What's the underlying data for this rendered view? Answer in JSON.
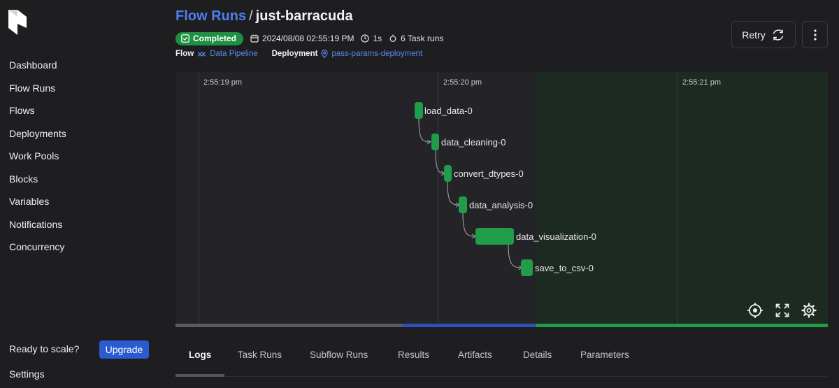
{
  "sidebar": {
    "items": [
      {
        "label": "Dashboard"
      },
      {
        "label": "Flow Runs"
      },
      {
        "label": "Flows"
      },
      {
        "label": "Deployments"
      },
      {
        "label": "Work Pools"
      },
      {
        "label": "Blocks"
      },
      {
        "label": "Variables"
      },
      {
        "label": "Notifications"
      },
      {
        "label": "Concurrency"
      }
    ],
    "ready_text": "Ready to scale?",
    "upgrade_label": "Upgrade",
    "settings_label": "Settings"
  },
  "header": {
    "breadcrumb": "Flow Runs",
    "separator": "/",
    "run_name": "just-barracuda",
    "status": "Completed",
    "start_time": "2024/08/08 02:55:19 PM",
    "duration": "1s",
    "task_runs": "6 Task runs",
    "flow_label": "Flow",
    "flow_name": "Data Pipeline",
    "deployment_label": "Deployment",
    "deployment_name": "pass-params-deployment",
    "retry_label": "Retry"
  },
  "timeline": {
    "ticks": [
      "2:55:19 pm",
      "2:55:20 pm",
      "2:55:21 pm"
    ],
    "tasks": [
      {
        "name": "load_data-0"
      },
      {
        "name": "data_cleaning-0"
      },
      {
        "name": "convert_dtypes-0"
      },
      {
        "name": "data_analysis-0"
      },
      {
        "name": "data_visualization-0"
      },
      {
        "name": "save_to_csv-0"
      }
    ],
    "colors": {
      "task": "#1f9d48",
      "progress_gray": "#5a5a60",
      "progress_blue": "#2b50b8",
      "progress_green": "#1f9d48"
    },
    "controls": [
      "crosshair-icon",
      "expand-icon",
      "settings-icon"
    ]
  },
  "tabs": [
    "Logs",
    "Task Runs",
    "Subflow Runs",
    "Results",
    "Artifacts",
    "Details",
    "Parameters"
  ],
  "active_tab": "Logs"
}
